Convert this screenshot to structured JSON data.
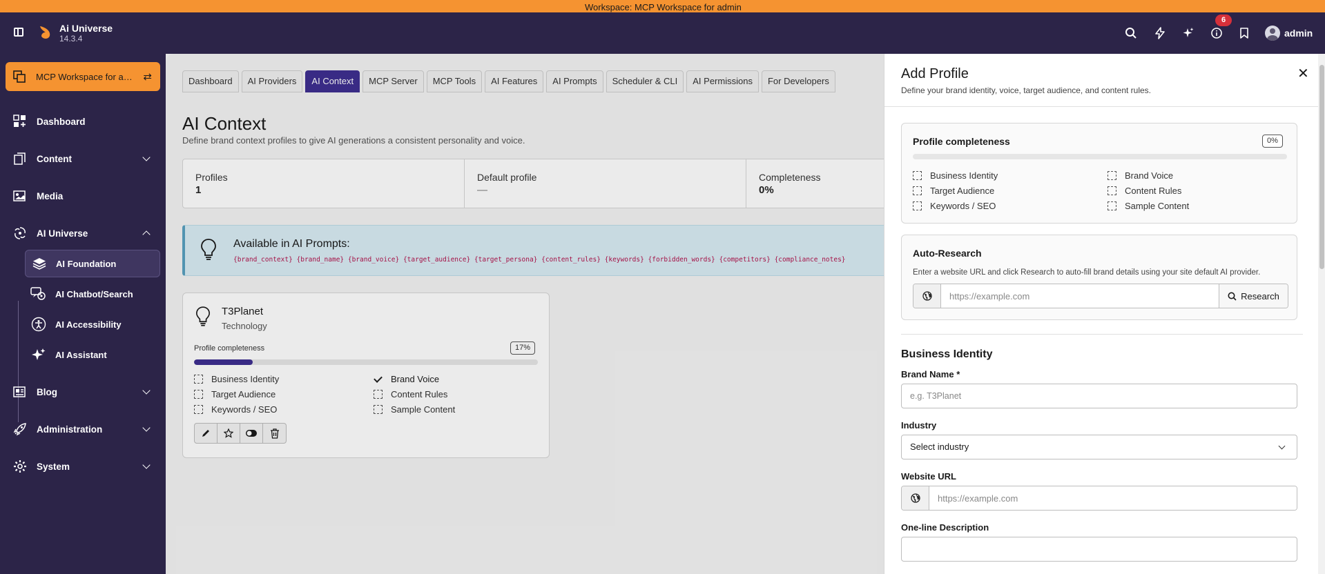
{
  "workspace_strip": {
    "text": "Workspace: MCP Workspace for admin"
  },
  "topbar": {
    "app_name": "Ai Universe",
    "version": "14.3.4",
    "notification_count": "6",
    "user": "admin",
    "icons": [
      "search-icon",
      "bolt-icon",
      "sparkle-icon",
      "info-icon",
      "bookmark-icon"
    ]
  },
  "sidebar": {
    "workspace_label": "MCP Workspace for admin",
    "items": [
      {
        "label": "Dashboard",
        "icon": "dashboard-icon"
      },
      {
        "label": "Content",
        "icon": "content-icon"
      },
      {
        "label": "Media",
        "icon": "media-icon"
      },
      {
        "label": "AI Universe",
        "icon": "galaxy-icon"
      },
      {
        "label": "Blog",
        "icon": "blog-icon"
      },
      {
        "label": "Administration",
        "icon": "rocket-icon"
      },
      {
        "label": "System",
        "icon": "gear-icon"
      }
    ],
    "subitems": [
      {
        "label": "AI Foundation",
        "icon": "layers-icon"
      },
      {
        "label": "AI Chatbot/Search",
        "icon": "chatbot-icon"
      },
      {
        "label": "AI Accessibility",
        "icon": "accessibility-icon"
      },
      {
        "label": "AI Assistant",
        "icon": "sparkle-icon"
      }
    ]
  },
  "main": {
    "tabs": [
      "Dashboard",
      "AI Providers",
      "AI Context",
      "MCP Server",
      "MCP Tools",
      "AI Features",
      "AI Prompts",
      "Scheduler & CLI",
      "AI Permissions",
      "For Developers"
    ],
    "active_tab": "AI Context",
    "title": "AI Context",
    "subtitle": "Define brand context profiles to give AI generations a consistent personality and voice.",
    "stats": [
      {
        "label": "Profiles",
        "value": "1"
      },
      {
        "label": "Default profile",
        "value": "—"
      },
      {
        "label": "Completeness",
        "value": "0%"
      }
    ],
    "info": {
      "heading": "Available in AI Prompts:",
      "variables": "{brand_context} {brand_name} {brand_voice} {target_audience} {target_persona} {content_rules} {keywords} {forbidden_words} {competitors} {compliance_notes}"
    },
    "profile_card": {
      "name": "T3Planet",
      "industry": "Technology",
      "completeness_label": "Profile completeness",
      "completeness_pct": "17%",
      "completeness_value": 0.17,
      "checks": [
        {
          "label": "Business Identity",
          "done": false
        },
        {
          "label": "Brand Voice",
          "done": true
        },
        {
          "label": "Target Audience",
          "done": false
        },
        {
          "label": "Content Rules",
          "done": false
        },
        {
          "label": "Keywords / SEO",
          "done": false
        },
        {
          "label": "Sample Content",
          "done": false
        }
      ],
      "actions": [
        "edit-icon",
        "star-icon",
        "toggle-icon",
        "trash-icon"
      ]
    }
  },
  "drawer": {
    "title": "Add Profile",
    "subtitle": "Define your brand identity, voice, target audience, and content rules.",
    "completeness": {
      "title": "Profile completeness",
      "pct": "0%",
      "value": 0,
      "checks": [
        "Business Identity",
        "Brand Voice",
        "Target Audience",
        "Content Rules",
        "Keywords / SEO",
        "Sample Content"
      ]
    },
    "auto_research": {
      "title": "Auto-Research",
      "desc": "Enter a website URL and click Research to auto-fill brand details using your site default AI provider.",
      "placeholder": "https://example.com",
      "button": "Research"
    },
    "section": "Business Identity",
    "fields": {
      "brand_name_label": "Brand Name *",
      "brand_name_placeholder": "e.g. T3Planet",
      "industry_label": "Industry",
      "industry_value": "Select industry",
      "website_label": "Website URL",
      "website_placeholder": "https://example.com",
      "description_label": "One-line Description",
      "description_value": ""
    }
  }
}
